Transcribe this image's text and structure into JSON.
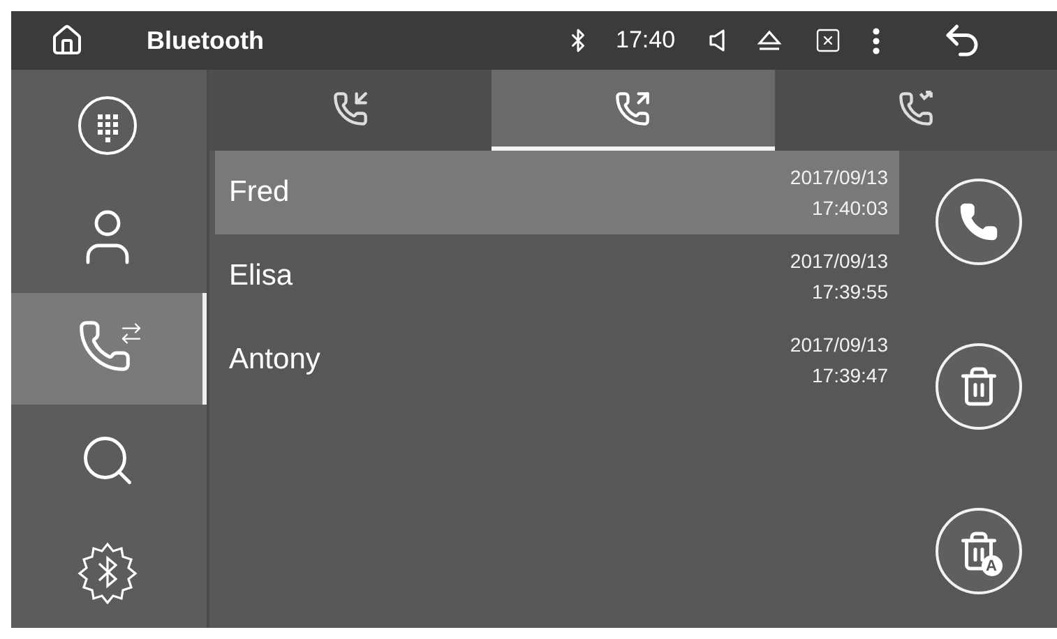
{
  "top_bar": {
    "title": "Bluetooth",
    "time": "17:40"
  },
  "sidebar": {
    "items": [
      {
        "kind": "dialpad",
        "selected": false
      },
      {
        "kind": "contacts",
        "selected": false
      },
      {
        "kind": "call_log",
        "selected": true
      },
      {
        "kind": "search",
        "selected": false
      },
      {
        "kind": "bt_settings",
        "selected": false
      }
    ]
  },
  "tabs": [
    {
      "kind": "incoming",
      "selected": false
    },
    {
      "kind": "outgoing",
      "selected": true
    },
    {
      "kind": "missed",
      "selected": false
    }
  ],
  "calls": [
    {
      "name": "Fred",
      "date": "2017/09/13",
      "time": "17:40:03",
      "selected": true
    },
    {
      "name": "Elisa",
      "date": "2017/09/13",
      "time": "17:39:55",
      "selected": false
    },
    {
      "name": "Antony",
      "date": "2017/09/13",
      "time": "17:39:47",
      "selected": false
    }
  ],
  "actions": [
    {
      "kind": "call"
    },
    {
      "kind": "delete"
    },
    {
      "kind": "delete_all",
      "badge": "A"
    }
  ]
}
